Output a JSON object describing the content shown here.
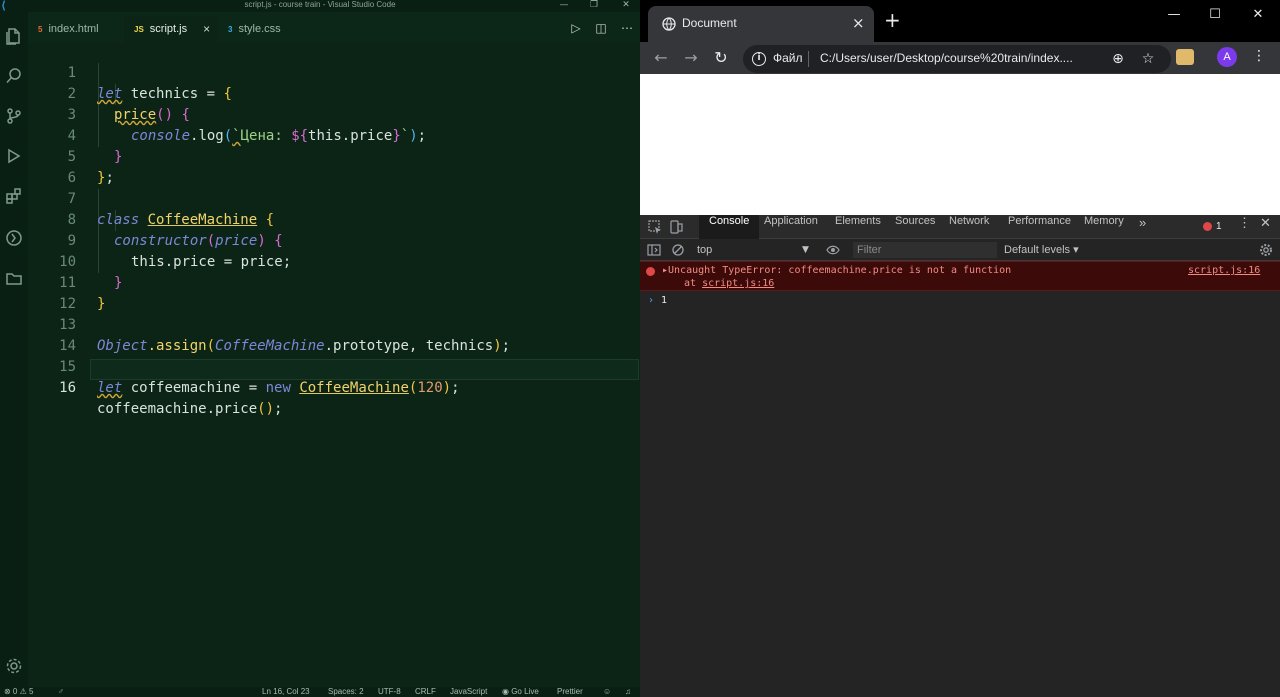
{
  "vscode": {
    "window_title": "script.js - course train - Visual Studio Code",
    "tabs": [
      {
        "label": "index.html",
        "icon": "html-file-icon",
        "icon_text": "5"
      },
      {
        "label": "script.js",
        "icon": "js-file-icon",
        "icon_text": "JS"
      },
      {
        "label": "style.css",
        "icon": "css-file-icon",
        "icon_text": "3"
      }
    ],
    "line_numbers": [
      "1",
      "2",
      "3",
      "4",
      "5",
      "6",
      "7",
      "8",
      "9",
      "10",
      "11",
      "12",
      "13",
      "14",
      "15",
      "16"
    ],
    "code": {
      "l1": {
        "kw": "let",
        "name": " technics ",
        "op": "= ",
        "brace": "{"
      },
      "l2": {
        "fn": "price",
        "paren": "()",
        "sp": " ",
        "brace": "{"
      },
      "l3": {
        "obj": "console",
        "dot": ".log",
        "paren1": "(",
        "tick1": "`",
        "str": "Цена: ",
        "tpl1": "${",
        "expr": "this.price",
        "tpl2": "}",
        "tick2": "`",
        "paren2": ")",
        "semi": ";"
      },
      "l4": {
        "brace": "}"
      },
      "l5": {
        "brace": "}",
        "semi": ";"
      },
      "l7": {
        "kw": "class",
        "sp": " ",
        "cls": "CoffeeMachine",
        "sp2": " ",
        "brace": "{"
      },
      "l8": {
        "kw": "constructor",
        "paren1": "(",
        "param": "price",
        "paren2": ")",
        "sp": " ",
        "brace": "{"
      },
      "l9": {
        "text": "this.price = price;"
      },
      "l10": {
        "brace": "}"
      },
      "l11": {
        "brace": "}"
      },
      "l13": {
        "obj": "Object",
        "fn": ".assign",
        "paren1": "(",
        "cls": "CoffeeMachine",
        "rest": ".prototype, technics",
        "paren2": ")",
        "semi": ";"
      },
      "l15": {
        "kw": "let",
        "name": " coffeemachine = ",
        "kw2": "new",
        "sp": " ",
        "cls": "CoffeeMachine",
        "paren1": "(",
        "num": "120",
        "paren2": ")",
        "semi": ";"
      },
      "l16": {
        "text": "coffeemachine.price",
        "paren": "()",
        "semi": ";"
      }
    },
    "status": {
      "problems": "⊗ 0 ⚠ 5",
      "cursor": "Ln 16, Col 23",
      "spaces": "Spaces: 2",
      "encoding": "UTF-8",
      "eol": "CRLF",
      "language": "JavaScript",
      "golive": "◉ Go Live",
      "prettier": "Prettier"
    }
  },
  "chrome": {
    "tab_title": "Document",
    "omnibox_scheme": "Файл",
    "url": "C:/Users/user/Desktop/course%20train/index....",
    "avatar_letter": "A",
    "devtools": {
      "tabs": [
        "Console",
        "Application",
        "Elements",
        "Sources",
        "Network",
        "Performance",
        "Memory"
      ],
      "more": "»",
      "error_count": "1",
      "context": "top",
      "filter_placeholder": "Filter",
      "levels": "Default levels ▾",
      "error": {
        "message": "▸Uncaught TypeError: coffeemachine.price is not a function",
        "stack_prefix": "at ",
        "stack_link": "script.js:16",
        "source": "script.js:16"
      },
      "prompt_value": "1"
    }
  },
  "colors": {
    "vscode_bg": "#0b2416",
    "chrome_dark": "#202124",
    "error_bg": "#3d0a0a",
    "error_text": "#f28b82"
  }
}
